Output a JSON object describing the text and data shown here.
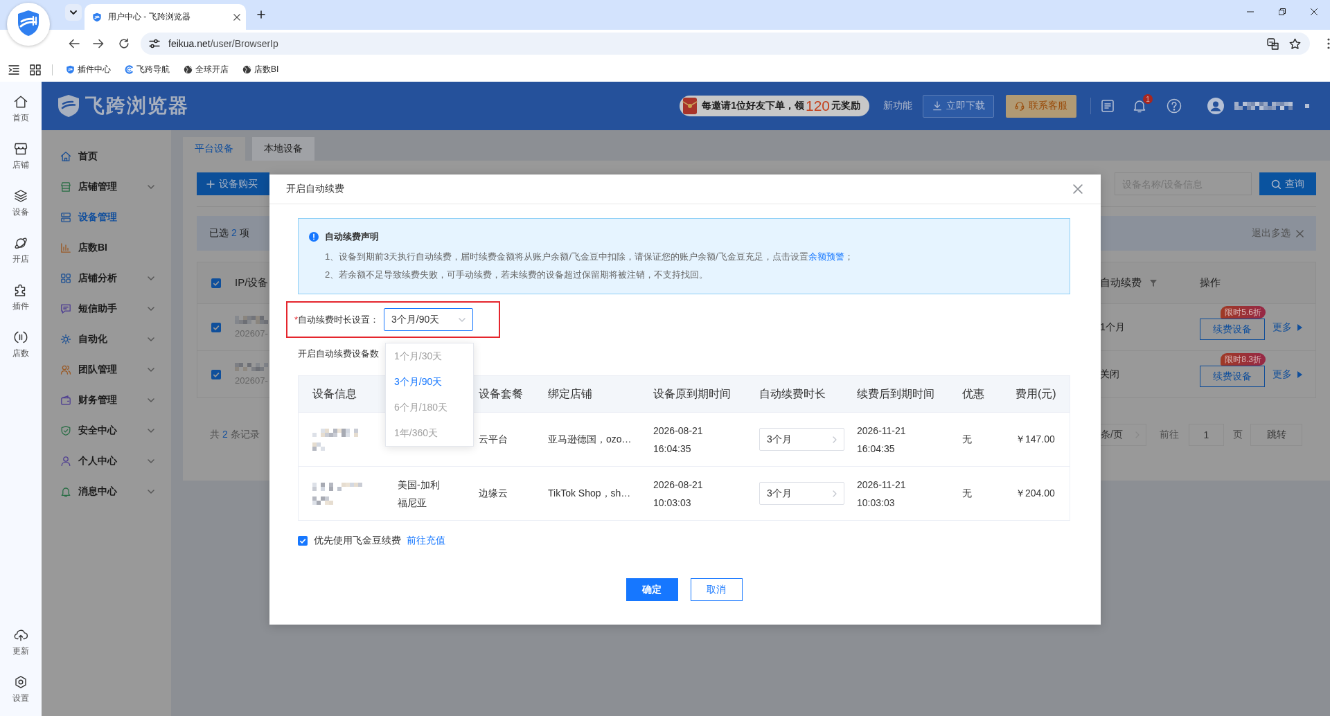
{
  "browser": {
    "tab_title": "用户中心 - 飞跨浏览器",
    "url_host": "feikua.net",
    "url_path": "/user/BrowserIp",
    "bookmarks": [
      {
        "label": "插件中心"
      },
      {
        "label": "飞跨导航"
      },
      {
        "label": "全球开店"
      },
      {
        "label": "店数BI"
      }
    ]
  },
  "rail": {
    "items": [
      {
        "label": "首页"
      },
      {
        "label": "店铺"
      },
      {
        "label": "设备"
      },
      {
        "label": "开店"
      },
      {
        "label": "插件"
      },
      {
        "label": "店数"
      }
    ],
    "bottom_items": [
      {
        "label": "更新"
      },
      {
        "label": "设置"
      }
    ]
  },
  "header": {
    "logo_text": "飞跨浏览器",
    "promo_text": "每邀请1位好友下单，领",
    "promo_amount": "120",
    "promo_suffix": "元奖励",
    "new_features": "新功能",
    "download": "立即下载",
    "support": "联系客服",
    "notification_count": "1"
  },
  "sidebar": {
    "items": [
      {
        "label": "首页",
        "selected": false,
        "has_submenu": false
      },
      {
        "label": "店铺管理",
        "selected": false,
        "has_submenu": true
      },
      {
        "label": "设备管理",
        "selected": true,
        "has_submenu": false
      },
      {
        "label": "店数BI",
        "selected": false,
        "has_submenu": false
      },
      {
        "label": "店铺分析",
        "selected": false,
        "has_submenu": true
      },
      {
        "label": "短信助手",
        "selected": false,
        "has_submenu": true
      },
      {
        "label": "自动化",
        "selected": false,
        "has_submenu": true
      },
      {
        "label": "团队管理",
        "selected": false,
        "has_submenu": true
      },
      {
        "label": "财务管理",
        "selected": false,
        "has_submenu": true
      },
      {
        "label": "安全中心",
        "selected": false,
        "has_submenu": true
      },
      {
        "label": "个人中心",
        "selected": false,
        "has_submenu": true
      },
      {
        "label": "消息中心",
        "selected": false,
        "has_submenu": true
      }
    ]
  },
  "tabs": [
    {
      "label": "平台设备",
      "selected": true
    },
    {
      "label": "本地设备",
      "selected": false
    }
  ],
  "toolbar": {
    "purchase": "设备购买",
    "search_placeholder": "设备名称/设备信息",
    "query": "查询"
  },
  "selection_bar": {
    "prefix": "已选",
    "count": "2",
    "suffix": "项",
    "exit": "退出多选"
  },
  "device_table": {
    "all_checked": true,
    "column_device": "IP/设备",
    "column_auto_renew": "自动续费",
    "column_actions": "操作",
    "rows": [
      {
        "checked": true,
        "created": "202607-",
        "auto_renew": "1个月",
        "badge": "限时5.6折",
        "renew": "续费设备",
        "more": "更多"
      },
      {
        "checked": true,
        "created": "202607-",
        "auto_renew": "关闭",
        "badge": "限时8.3折",
        "renew": "续费设备",
        "more": "更多"
      }
    ]
  },
  "pagination": {
    "total_prefix": "共",
    "total": "2",
    "total_suffix": "条记录",
    "page_size": "条/页",
    "goto": "前往",
    "page": "1",
    "page_unit": "页",
    "jump": "跳转"
  },
  "modal": {
    "title": "开启自动续费",
    "notice": {
      "title": "自动续费声明",
      "lines": [
        {
          "text": "1、设备到期前3天执行自动续费，届时续费金额将从账户余额/飞金豆中扣除，请保证您的账户余额/飞金豆充足，点击设置",
          "link": "余额预警",
          "after": "；"
        },
        {
          "text": "2、若余额不足导致续费失败，可手动续费，若未续费的设备超过保留期将被注销，不支持找回。"
        }
      ]
    },
    "duration": {
      "required_mark": "*",
      "label": "自动续费时长设置：",
      "value": "3个月/90天",
      "highlighted": true,
      "open": true,
      "options": [
        {
          "label": "1个月/30天",
          "selected": false
        },
        {
          "label": "3个月/90天",
          "selected": true
        },
        {
          "label": "6个月/180天",
          "selected": false
        },
        {
          "label": "1年/360天",
          "selected": false
        }
      ]
    },
    "count_label": "开启自动续费设备数",
    "table": {
      "columns": {
        "device_info": "设备信息",
        "plan": "设备套餐",
        "shop": "绑定店铺",
        "original_expiry": "设备原到期时间",
        "renew_duration": "自动续费时长",
        "new_expiry": "续费后到期时间",
        "discount": "优惠",
        "fee": "费用(元)"
      },
      "rows": [
        {
          "plan": "云平台",
          "shop": "亚马逊德国，ozo…",
          "original_expiry": "2026-08-21 16:04:35",
          "renew_duration": "3个月",
          "new_expiry": "2026-11-21 16:04:35",
          "discount": "无",
          "fee": "￥147.00"
        },
        {
          "region": "美国-加利福尼亚",
          "plan": "边缘云",
          "shop": "TikTok Shop，sh…",
          "original_expiry": "2026-08-21 10:03:03",
          "renew_duration": "3个月",
          "new_expiry": "2026-11-21 10:03:03",
          "discount": "无",
          "fee": "￥204.00"
        }
      ]
    },
    "prefer_beans": {
      "checked": true,
      "label": "优先使用飞金豆续费",
      "link": "前往充值"
    },
    "buttons": [
      {
        "label": "确定",
        "kind": "primary"
      },
      {
        "label": "取消",
        "kind": "secondary"
      }
    ]
  }
}
